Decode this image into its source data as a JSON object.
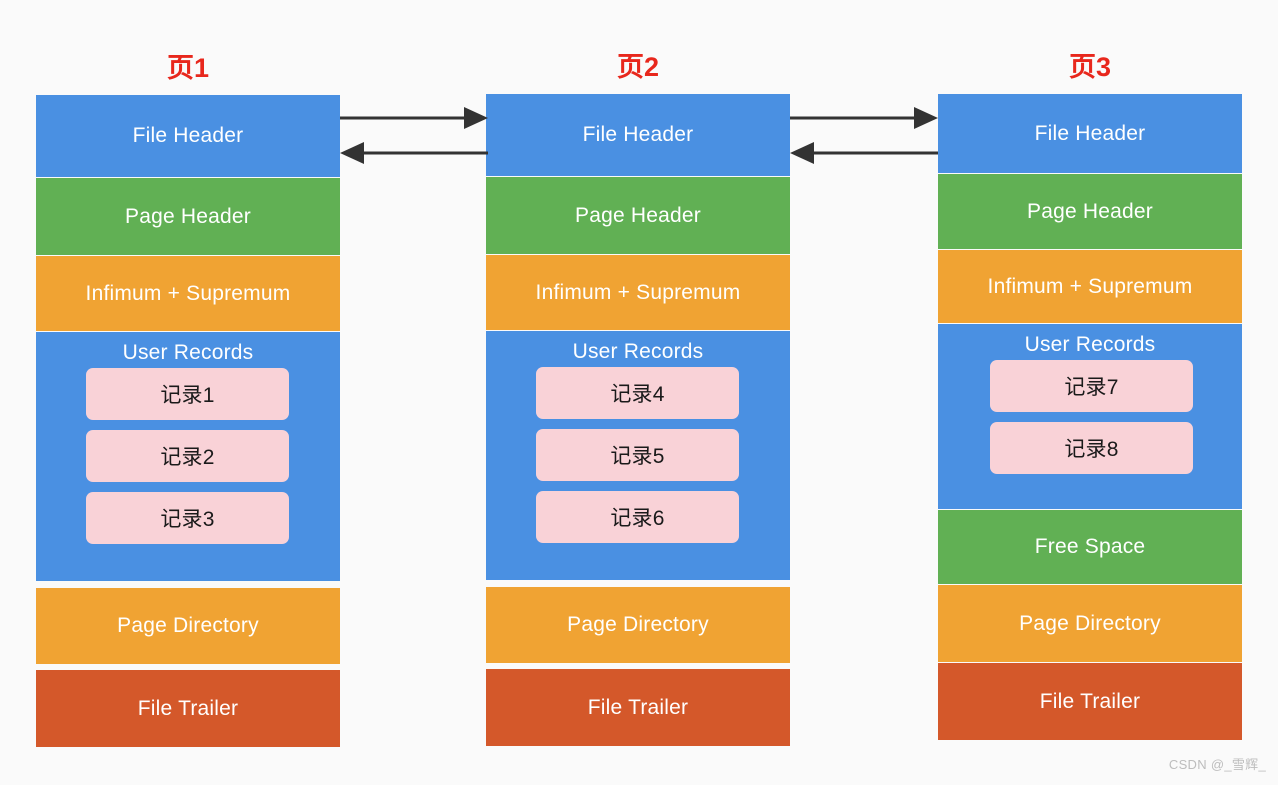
{
  "diagram": {
    "title_color": "#e8271c",
    "background": "#fafafa",
    "palette": {
      "file_header": "#4a90e2",
      "page_header": "#61b054",
      "infimum_supremum": "#f0a333",
      "user_records": "#4a90e2",
      "free_space": "#61b054",
      "page_directory": "#f0a333",
      "file_trailer": "#d4582a",
      "record_chip": "#f9d2d7",
      "arrow": "#333333"
    },
    "pages": [
      {
        "title": "页1",
        "blocks": [
          {
            "label": "File Header",
            "kind": "file-header"
          },
          {
            "label": "Page Header",
            "kind": "page-header"
          },
          {
            "label": "Infimum + Supremum",
            "kind": "infimum-supremum"
          },
          {
            "label": "User Records",
            "kind": "user-records",
            "records": [
              "记录1",
              "记录2",
              "记录3"
            ]
          },
          {
            "label": "Page Directory",
            "kind": "page-directory"
          },
          {
            "label": "File Trailer",
            "kind": "file-trailer"
          }
        ]
      },
      {
        "title": "页2",
        "blocks": [
          {
            "label": "File Header",
            "kind": "file-header"
          },
          {
            "label": "Page Header",
            "kind": "page-header"
          },
          {
            "label": "Infimum + Supremum",
            "kind": "infimum-supremum"
          },
          {
            "label": "User Records",
            "kind": "user-records",
            "records": [
              "记录4",
              "记录5",
              "记录6"
            ]
          },
          {
            "label": "Page Directory",
            "kind": "page-directory"
          },
          {
            "label": "File Trailer",
            "kind": "file-trailer"
          }
        ]
      },
      {
        "title": "页3",
        "blocks": [
          {
            "label": "File Header",
            "kind": "file-header"
          },
          {
            "label": "Page Header",
            "kind": "page-header"
          },
          {
            "label": "Infimum + Supremum",
            "kind": "infimum-supremum"
          },
          {
            "label": "User Records",
            "kind": "user-records",
            "records": [
              "记录7",
              "记录8"
            ]
          },
          {
            "label": "Free Space",
            "kind": "free-space"
          },
          {
            "label": "Page Directory",
            "kind": "page-directory"
          },
          {
            "label": "File Trailer",
            "kind": "file-trailer"
          }
        ]
      }
    ],
    "connectors": [
      {
        "from": "页1",
        "to": "页2",
        "direction": "right"
      },
      {
        "from": "页2",
        "to": "页1",
        "direction": "left"
      },
      {
        "from": "页2",
        "to": "页3",
        "direction": "right"
      },
      {
        "from": "页3",
        "to": "页2",
        "direction": "left"
      }
    ]
  },
  "watermark": "CSDN @_雪辉_"
}
